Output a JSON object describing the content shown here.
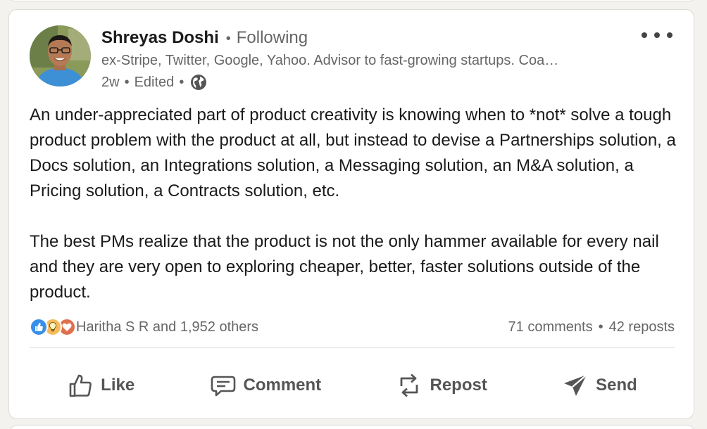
{
  "post": {
    "author": {
      "name": "Shreyas Doshi",
      "separator": "•",
      "follow_status": "Following",
      "headline": "ex-Stripe, Twitter, Google, Yahoo. Advisor to fast-growing startups. Coa…",
      "timestamp": "2w",
      "edited": "Edited",
      "visibility_icon": "globe-icon"
    },
    "more_icon": "more-horizontal-icon",
    "body": [
      "An under-appreciated part of product creativity is knowing when to *not* solve a tough product problem with the product at all, but instead to devise a Partnerships solution, a Docs solution, an Integrations solution, a Messaging solution, an M&A solution, a Pricing solution, a Contracts solution, etc.",
      "The best PMs realize that the product is not the only hammer available for every nail and they are very open to exploring cheaper, better, faster solutions outside of the product."
    ],
    "social": {
      "reaction_icons": [
        "like-icon",
        "insightful-icon",
        "love-icon"
      ],
      "reactions_text": "Haritha S R and 1,952 others",
      "comments": "71 comments",
      "reposts": "42 reposts"
    },
    "actions": [
      {
        "label": "Like",
        "icon": "thumbs-up-icon"
      },
      {
        "label": "Comment",
        "icon": "comment-icon"
      },
      {
        "label": "Repost",
        "icon": "repost-icon"
      },
      {
        "label": "Send",
        "icon": "send-icon"
      }
    ],
    "colors": {
      "like_reaction": "#378fe9",
      "insightful_reaction": "#f5bb5c",
      "love_reaction": "#df704d",
      "secondary_text": "#666666",
      "background": "#f4f2ee"
    }
  }
}
